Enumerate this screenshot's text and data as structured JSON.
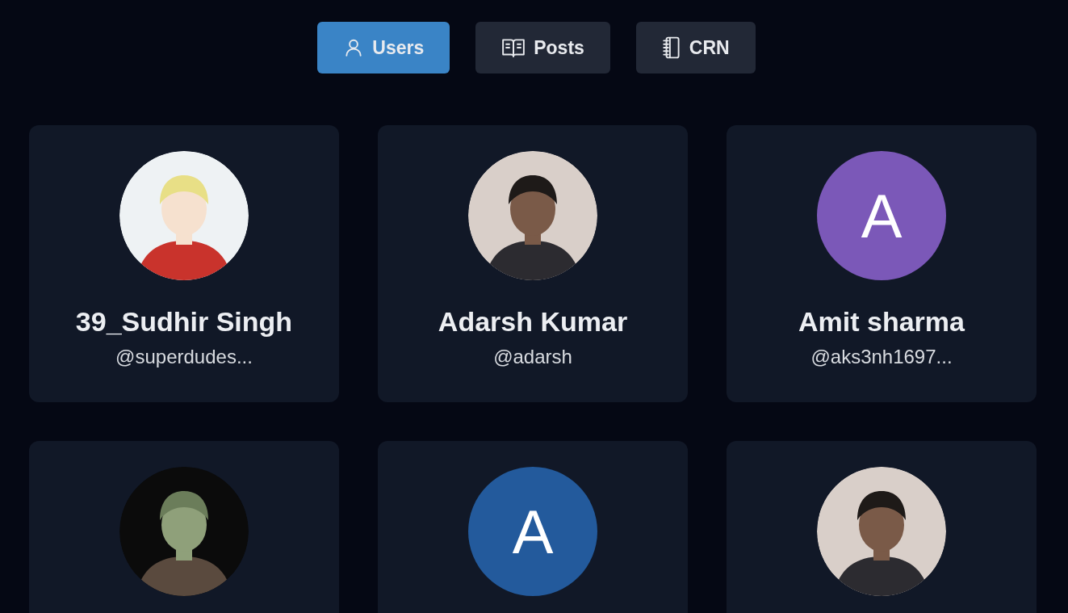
{
  "tabs": [
    {
      "label": "Users",
      "selected": true
    },
    {
      "label": "Posts",
      "selected": false
    },
    {
      "label": "CRN",
      "selected": false
    }
  ],
  "users": [
    {
      "avatar": {
        "kind": "picture"
      },
      "name": "39_Sudhir Singh",
      "handle": "@superdudes..."
    },
    {
      "avatar": {
        "kind": "picture"
      },
      "name": "Adarsh Kumar",
      "handle": "@adarsh"
    },
    {
      "avatar": {
        "kind": "letter",
        "letter": "A",
        "color": "#7b58b8"
      },
      "name": "Amit sharma",
      "handle": "@aks3nh1697..."
    },
    {
      "avatar": {
        "kind": "picture"
      }
    },
    {
      "avatar": {
        "kind": "letter",
        "letter": "A",
        "color": "#235a9c"
      }
    },
    {
      "avatar": {
        "kind": "picture"
      }
    }
  ]
}
